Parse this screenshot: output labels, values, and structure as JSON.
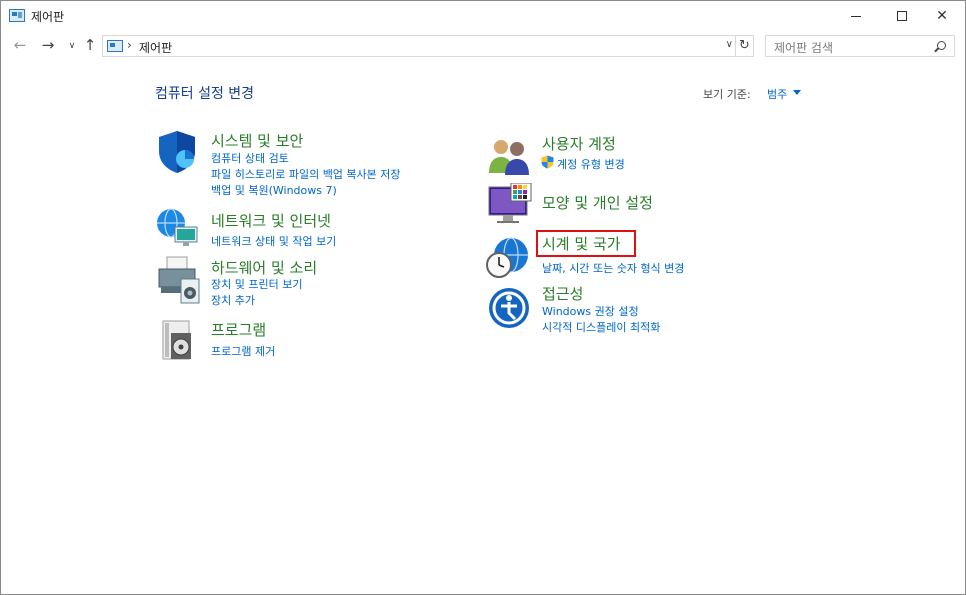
{
  "window": {
    "title": "제어판"
  },
  "address": {
    "path": "제어판",
    "search_placeholder": "제어판 검색"
  },
  "header": {
    "title": "컴퓨터 설정 변경",
    "view_by_label": "보기 기준:",
    "view_by_value": "범주"
  },
  "left_categories": [
    {
      "title": "시스템 및 보안",
      "links": [
        "컴퓨터 상태 검토",
        "파일 히스토리로 파일의 백업 복사본 저장",
        "백업 및 복원(Windows 7)"
      ]
    },
    {
      "title": "네트워크 및 인터넷",
      "links": [
        "네트워크 상태 및 작업 보기"
      ]
    },
    {
      "title": "하드웨어 및 소리",
      "links": [
        "장치 및 프린터 보기",
        "장치 추가"
      ]
    },
    {
      "title": "프로그램",
      "links": [
        "프로그램 제거"
      ]
    }
  ],
  "right_categories": [
    {
      "title": "사용자 계정",
      "links": [
        "계정 유형 변경"
      ]
    },
    {
      "title": "모양 및 개인 설정",
      "links": []
    },
    {
      "title": "시계 및 국가",
      "links": [
        "날짜, 시간 또는 숫자 형식 변경"
      ]
    },
    {
      "title": "접근성",
      "links": [
        "Windows 권장 설정",
        "시각적 디스플레이 최적화"
      ]
    }
  ],
  "icons": [
    "control-panel-icon",
    "shield-icon",
    "network-globe-icon",
    "printer-icon",
    "programs-disc-icon",
    "users-icon",
    "uac-shield-icon",
    "monitor-palette-icon",
    "clock-globe-icon",
    "accessibility-icon",
    "search-icon",
    "refresh-icon"
  ],
  "colors": {
    "category_title": "#2a7d2a",
    "link": "#0066cc",
    "page_title": "#1a3e8c",
    "highlight": "#e01010"
  }
}
